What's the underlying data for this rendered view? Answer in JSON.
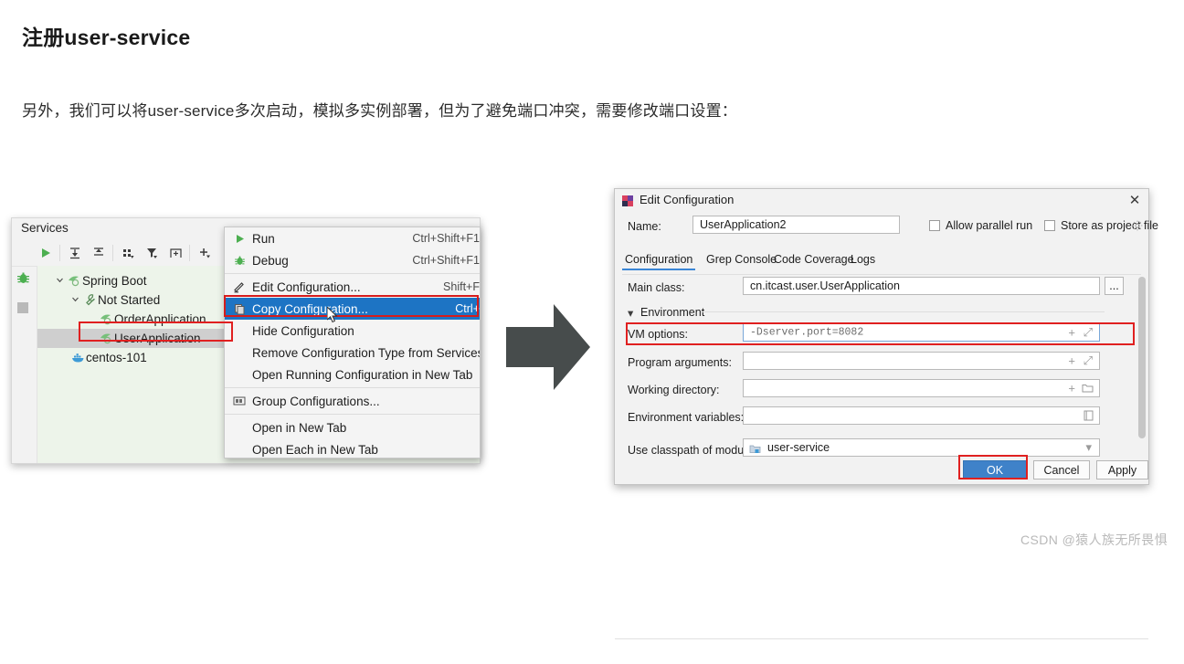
{
  "article": {
    "title": "注册user-service",
    "paragraph": "另外，我们可以将user-service多次启动，模拟多实例部署，但为了避免端口冲突，需要修改端口设置："
  },
  "watermark": "CSDN @猿人族无所畏惧",
  "services_panel": {
    "title": "Services",
    "toolbar": [
      {
        "name": "run-icon",
        "glyph": "▶"
      },
      {
        "name": "expand-all-icon",
        "glyph": "⤓"
      },
      {
        "name": "collapse-all-icon",
        "glyph": "⤒"
      },
      {
        "name": "group-by-icon",
        "glyph": "⠿"
      },
      {
        "name": "filter-icon",
        "glyph": "▼"
      },
      {
        "name": "add-tab-icon",
        "glyph": "[+]"
      },
      {
        "name": "add-service-icon",
        "glyph": "+"
      }
    ],
    "sidebar": [
      {
        "name": "debug-icon",
        "glyph": "bug"
      },
      {
        "name": "stop-icon",
        "glyph": "square"
      }
    ],
    "tree": [
      {
        "label": "Spring Boot",
        "indent": 0,
        "chevron": "▾",
        "icon": "spring-boot-icon",
        "selected": false
      },
      {
        "label": "Not Started",
        "indent": 1,
        "chevron": "▾",
        "icon": "wrench-icon",
        "selected": false
      },
      {
        "label": "OrderApplication",
        "indent": 2,
        "chevron": "",
        "icon": "spring-boot-icon",
        "selected": false
      },
      {
        "label": "UserApplication",
        "indent": 2,
        "chevron": "",
        "icon": "spring-boot-icon",
        "selected": true
      },
      {
        "label": "centos-101",
        "indent": 1,
        "chevron": "",
        "icon": "docker-icon",
        "selected": false
      }
    ]
  },
  "context_menu": {
    "items": [
      {
        "label": "Run",
        "shortcut": "Ctrl+Shift+F1",
        "icon": "run-icon",
        "active": false
      },
      {
        "label": "Debug",
        "shortcut": "Ctrl+Shift+F1",
        "icon": "debug-icon",
        "active": false
      },
      {
        "sep": true
      },
      {
        "label": "Edit Configuration...",
        "shortcut": "Shift+F",
        "icon": "pencil-icon",
        "active": false
      },
      {
        "label": "Copy Configuration...",
        "shortcut": "Ctrl+",
        "icon": "copy-icon",
        "active": true
      },
      {
        "label": "Hide Configuration",
        "shortcut": "",
        "icon": "",
        "active": false
      },
      {
        "label": "Remove Configuration Type from Services",
        "shortcut": "",
        "icon": "",
        "active": false
      },
      {
        "label": "Open Running Configuration in New Tab",
        "shortcut": "",
        "icon": "",
        "active": false
      },
      {
        "sep": true
      },
      {
        "label": "Group Configurations...",
        "shortcut": "",
        "icon": "group-icon",
        "active": false
      },
      {
        "sep": true
      },
      {
        "label": "Open in New Tab",
        "shortcut": "",
        "icon": "",
        "active": false
      },
      {
        "label": "Open Each in New Tab",
        "shortcut": "",
        "icon": "",
        "active": false
      }
    ]
  },
  "dialog": {
    "title": "Edit Configuration",
    "close_glyph": "✕",
    "name_label": "Name:",
    "name_value": "UserApplication2",
    "allow_parallel_run_label": "Allow parallel run",
    "allow_parallel_run_checked": false,
    "store_as_project_file_label": "Store as project file",
    "store_as_project_file_checked": false,
    "tabs": [
      {
        "label": "Configuration",
        "active": true
      },
      {
        "label": "Grep Console",
        "active": false
      },
      {
        "label": "Code Coverage",
        "active": false
      },
      {
        "label": "Logs",
        "active": false
      }
    ],
    "main_class_label": "Main class:",
    "main_class_value": "cn.itcast.user.UserApplication",
    "browse_button_label": "...",
    "environment_section_label": "Environment",
    "environment_section_chevron": "▾",
    "vm_options_label": "VM options:",
    "vm_options_value": "-Dserver.port=8082",
    "program_arguments_label": "Program arguments:",
    "program_arguments_value": "",
    "working_directory_label": "Working directory:",
    "working_directory_value": "",
    "environment_variables_label": "Environment variables:",
    "environment_variables_value": "",
    "classpath_label": "Use classpath of module:",
    "classpath_value": "user-service",
    "help_glyph": "?",
    "buttons": {
      "ok": "OK",
      "cancel": "Cancel",
      "apply": "Apply"
    }
  },
  "colors": {
    "highlight_red": "#e02020",
    "menu_selection_blue": "#1d74c4",
    "primary_button_blue": "#3f82c9",
    "tree_background": "#edf4ea"
  }
}
